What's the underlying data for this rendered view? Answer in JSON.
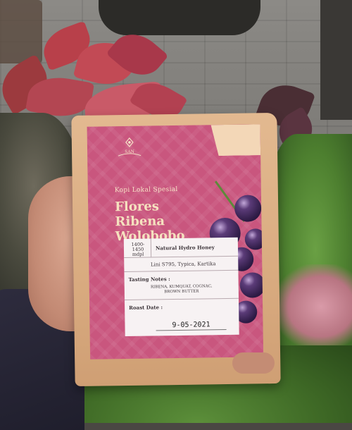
{
  "bag": {
    "brand_logo_text": "SAN",
    "subtitle": "Kopi Lokal Spesial",
    "name_lines": [
      "Flores",
      "Ribena",
      "Wolobobo"
    ],
    "altitude": "1400-\n1450\nmdpl",
    "process": "Natural Hydro Honey",
    "variety": "Lini S795, Typica, Kartika",
    "tasting_label": "Tasting Notes :",
    "tasting_notes": "RIBENA, KUMQUAT, COGNAC,\nBROWN BUTTER",
    "roast_label": "Roast Date :",
    "roast_date": "9-05-2021"
  },
  "colors": {
    "label_pink": "#c9567e",
    "kraft": "#dcae84",
    "berry": "#2e1b45"
  }
}
